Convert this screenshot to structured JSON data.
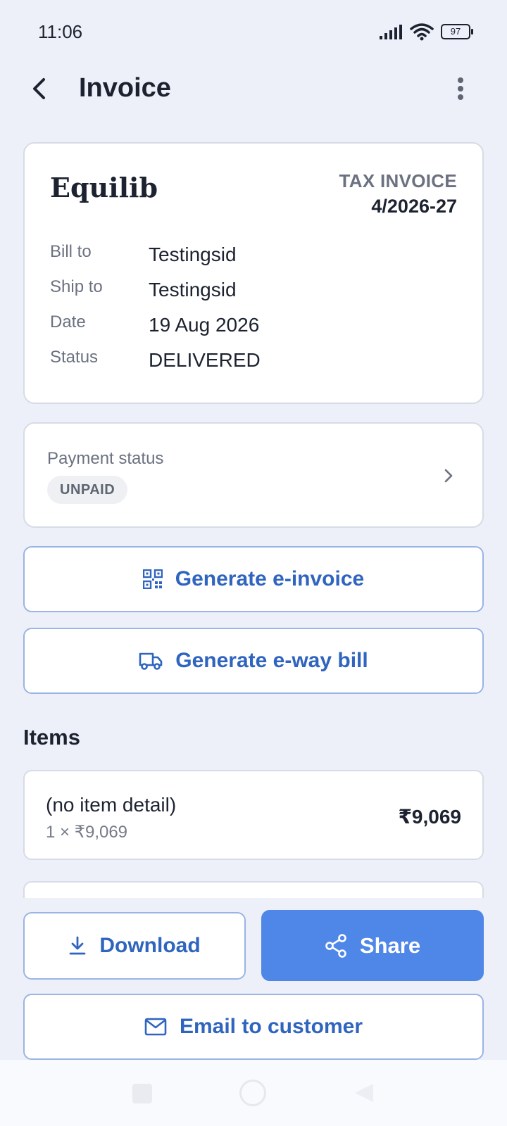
{
  "status_bar": {
    "time": "11:06",
    "battery": "97",
    "icons": [
      "signal-icon",
      "wifi-icon",
      "battery-icon"
    ]
  },
  "app_bar": {
    "title": "Invoice",
    "icons": [
      "back-arrow-icon",
      "more-vertical-icon"
    ]
  },
  "invoice": {
    "brand": "Equilib",
    "doc_type": "TAX INVOICE",
    "number": "4/2026-27",
    "fields": [
      {
        "label": "Bill to",
        "value": "Testingsid"
      },
      {
        "label": "Ship to",
        "value": "Testingsid"
      },
      {
        "label": "Date",
        "value": "19 Aug 2026"
      },
      {
        "label": "Status",
        "value": "DELIVERED"
      }
    ]
  },
  "payment": {
    "label": "Payment status",
    "badge": "UNPAID",
    "icon": "chevron-right-icon"
  },
  "actions": {
    "einvoice": {
      "label": "Generate e-invoice",
      "icon": "qr-code-icon"
    },
    "eway": {
      "label": "Generate e-way bill",
      "icon": "truck-icon"
    }
  },
  "items": {
    "title": "Items",
    "list": [
      {
        "name": "(no item detail)",
        "qty_line": "1 × ₹9,069",
        "amount": "₹9,069"
      }
    ]
  },
  "bottom": {
    "download": {
      "label": "Download",
      "icon": "download-icon"
    },
    "share": {
      "label": "Share",
      "icon": "share-icon"
    },
    "email": {
      "label": "Email to customer",
      "icon": "mail-icon"
    }
  },
  "colors": {
    "background": "#edf0f8",
    "accent": "#4f87e8",
    "accent_text": "#2f64bf",
    "outline": "#9ab4e3"
  }
}
